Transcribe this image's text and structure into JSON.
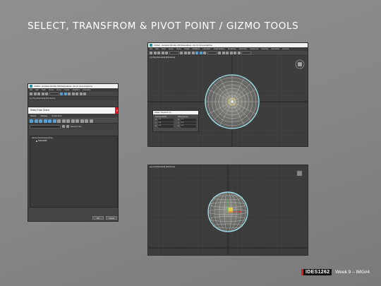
{
  "slide": {
    "title": "SELECT, TRANSFROM & PIVOT POINT / GIZMO TOOLS"
  },
  "footer": {
    "course": "IDES1262",
    "week": "Week 9 – IMG#4",
    "accent_color": "#d81e1e"
  },
  "left_window": {
    "title": "Untitled - Autodesk 3ds Max 2023 Educational - Not for Commercial Use",
    "menu": [
      "File",
      "Edit",
      "Tools",
      "Group",
      "Views",
      "Create",
      "Modifiers",
      "Animation"
    ],
    "breadcrumb": "[+] [Top] [Standard] [Wireframe]",
    "dialog": {
      "title": "Select From Scene",
      "close": "✕",
      "menu": [
        "Select",
        "Display",
        "Customize"
      ],
      "selection_set": "Selection Set:",
      "list_header": "Name (Sorted Ascending)",
      "items": [
        "Sphere001"
      ],
      "ok": "OK",
      "cancel": "Cancel"
    }
  },
  "top_window": {
    "title": "Untitled - Autodesk 3ds Max 2023 Educational - Not for Commercial Use",
    "menu": [
      "File",
      "Edit",
      "Tools",
      "Group",
      "Views",
      "Create",
      "Modifiers",
      "Animation",
      "Graph Editors",
      "Rendering",
      "Civil View",
      "Customize",
      "Scripting",
      "Interactive",
      "Content"
    ],
    "viewport_label": "[+] [Top] [Standard] [Wireframe]",
    "transform_dialog": {
      "title": "Rotate Transform Ty...",
      "absolute": "Absolute:World",
      "offset": "Offset:Screen",
      "abs_values": [
        [
          "X:",
          "0.0"
        ],
        [
          "Y:",
          "0.0"
        ],
        [
          "Z:",
          "0.0"
        ]
      ],
      "off_values": [
        [
          "X:",
          "0.0"
        ],
        [
          "Y:",
          "0.0"
        ],
        [
          "Z:",
          "0.0"
        ]
      ]
    }
  },
  "bottom_window": {
    "viewport_label": "[+] [Left] [Standard] [Wireframe]"
  }
}
